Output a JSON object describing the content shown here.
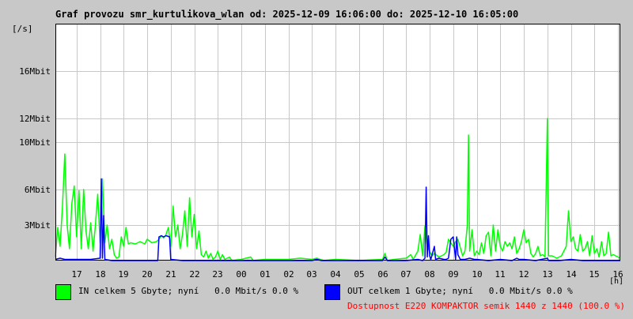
{
  "colors": {
    "background": "#c8c8c8",
    "plot_background": "#ffffff",
    "grid": "#c8c8c8",
    "in": "#00ff00",
    "out": "#0000ff",
    "availability": "#ff0000"
  },
  "chart_data": {
    "type": "line",
    "title": "Graf provozu smr_kurtulikova_wlan od: 2025-12-09 16:06:00 do: 2025-12-10 16:05:00",
    "ylabel": "[/s]",
    "xlabel": "[h]",
    "grid": true,
    "ylim": [
      0,
      20
    ],
    "xlim": [
      16.1,
      40.1
    ],
    "y_ticks": [
      {
        "value": 3,
        "label": "3Mbit"
      },
      {
        "value": 6,
        "label": "6Mbit"
      },
      {
        "value": 10,
        "label": "10Mbit"
      },
      {
        "value": 12,
        "label": "12Mbit"
      },
      {
        "value": 16,
        "label": "16Mbit"
      }
    ],
    "x_ticks": [
      {
        "value": 17,
        "label": "17"
      },
      {
        "value": 18,
        "label": "18"
      },
      {
        "value": 19,
        "label": "19"
      },
      {
        "value": 20,
        "label": "20"
      },
      {
        "value": 21,
        "label": "21"
      },
      {
        "value": 22,
        "label": "22"
      },
      {
        "value": 23,
        "label": "23"
      },
      {
        "value": 24,
        "label": "00"
      },
      {
        "value": 25,
        "label": "01"
      },
      {
        "value": 26,
        "label": "02"
      },
      {
        "value": 27,
        "label": "03"
      },
      {
        "value": 28,
        "label": "04"
      },
      {
        "value": 29,
        "label": "05"
      },
      {
        "value": 30,
        "label": "06"
      },
      {
        "value": 31,
        "label": "07"
      },
      {
        "value": 32,
        "label": "08"
      },
      {
        "value": 33,
        "label": "09"
      },
      {
        "value": 34,
        "label": "10"
      },
      {
        "value": 35,
        "label": "11"
      },
      {
        "value": 36,
        "label": "12"
      },
      {
        "value": 37,
        "label": "13"
      },
      {
        "value": 38,
        "label": "14"
      },
      {
        "value": 39,
        "label": "15"
      },
      {
        "value": 40,
        "label": "16"
      }
    ],
    "series": [
      {
        "name": "IN",
        "color": "#00ff00",
        "points": [
          [
            16.1,
            0.3
          ],
          [
            16.2,
            2.8
          ],
          [
            16.3,
            1.2
          ],
          [
            16.4,
            4.5
          ],
          [
            16.5,
            9.0
          ],
          [
            16.6,
            3.0
          ],
          [
            16.7,
            1.0
          ],
          [
            16.8,
            4.8
          ],
          [
            16.9,
            6.3
          ],
          [
            17.0,
            2.0
          ],
          [
            17.1,
            5.9
          ],
          [
            17.2,
            1.0
          ],
          [
            17.3,
            6.0
          ],
          [
            17.4,
            2.5
          ],
          [
            17.5,
            1.0
          ],
          [
            17.6,
            3.2
          ],
          [
            17.7,
            0.8
          ],
          [
            17.8,
            3.0
          ],
          [
            17.9,
            5.6
          ],
          [
            18.0,
            1.5
          ],
          [
            18.1,
            6.9
          ],
          [
            18.2,
            1.5
          ],
          [
            18.3,
            3.0
          ],
          [
            18.4,
            1.0
          ],
          [
            18.5,
            1.8
          ],
          [
            18.6,
            0.5
          ],
          [
            18.7,
            0.2
          ],
          [
            18.8,
            0.3
          ],
          [
            18.9,
            2.0
          ],
          [
            19.0,
            1.2
          ],
          [
            19.1,
            2.8
          ],
          [
            19.2,
            1.4
          ],
          [
            19.3,
            1.5
          ],
          [
            19.5,
            1.4
          ],
          [
            19.7,
            1.6
          ],
          [
            19.9,
            1.4
          ],
          [
            20.0,
            1.8
          ],
          [
            20.2,
            1.5
          ],
          [
            20.4,
            1.6
          ],
          [
            20.5,
            1.8
          ],
          [
            20.6,
            2.1
          ],
          [
            20.7,
            1.9
          ],
          [
            20.8,
            2.2
          ],
          [
            20.9,
            2.8
          ],
          [
            21.0,
            1.2
          ],
          [
            21.1,
            4.6
          ],
          [
            21.2,
            2.0
          ],
          [
            21.3,
            3.0
          ],
          [
            21.4,
            1.0
          ],
          [
            21.5,
            2.2
          ],
          [
            21.6,
            4.2
          ],
          [
            21.7,
            1.2
          ],
          [
            21.8,
            5.3
          ],
          [
            21.9,
            2.0
          ],
          [
            22.0,
            3.9
          ],
          [
            22.1,
            1.0
          ],
          [
            22.2,
            2.5
          ],
          [
            22.3,
            0.5
          ],
          [
            22.4,
            0.3
          ],
          [
            22.5,
            0.8
          ],
          [
            22.6,
            0.2
          ],
          [
            22.7,
            0.6
          ],
          [
            22.8,
            0.1
          ],
          [
            22.9,
            0.3
          ],
          [
            23.0,
            0.8
          ],
          [
            23.1,
            0.1
          ],
          [
            23.2,
            0.5
          ],
          [
            23.3,
            0.1
          ],
          [
            23.5,
            0.3
          ],
          [
            23.6,
            0.0
          ],
          [
            24.0,
            0.1
          ],
          [
            24.4,
            0.3
          ],
          [
            24.5,
            0.0
          ],
          [
            25.0,
            0.1
          ],
          [
            26.0,
            0.1
          ],
          [
            26.5,
            0.2
          ],
          [
            27.0,
            0.1
          ],
          [
            27.2,
            0.2
          ],
          [
            27.5,
            0.0
          ],
          [
            28.0,
            0.1
          ],
          [
            29.0,
            0.0
          ],
          [
            30.0,
            0.1
          ],
          [
            30.1,
            0.6
          ],
          [
            30.2,
            0.0
          ],
          [
            30.5,
            0.1
          ],
          [
            31.0,
            0.2
          ],
          [
            31.2,
            0.5
          ],
          [
            31.3,
            0.1
          ],
          [
            31.5,
            0.8
          ],
          [
            31.6,
            2.2
          ],
          [
            31.7,
            0.4
          ],
          [
            31.8,
            2.9
          ],
          [
            31.9,
            1.2
          ],
          [
            32.0,
            0.8
          ],
          [
            32.1,
            0.4
          ],
          [
            32.2,
            0.6
          ],
          [
            32.4,
            0.3
          ],
          [
            32.6,
            0.5
          ],
          [
            32.7,
            0.7
          ],
          [
            32.8,
            1.8
          ],
          [
            32.9,
            1.5
          ],
          [
            33.0,
            1.2
          ],
          [
            33.1,
            1.6
          ],
          [
            33.2,
            1.8
          ],
          [
            33.3,
            1.1
          ],
          [
            33.4,
            0.4
          ],
          [
            33.5,
            0.8
          ],
          [
            33.6,
            3.0
          ],
          [
            33.65,
            10.6
          ],
          [
            33.7,
            0.8
          ],
          [
            33.8,
            2.6
          ],
          [
            33.9,
            0.4
          ],
          [
            34.0,
            0.8
          ],
          [
            34.1,
            0.5
          ],
          [
            34.2,
            1.5
          ],
          [
            34.3,
            0.6
          ],
          [
            34.4,
            2.1
          ],
          [
            34.5,
            2.4
          ],
          [
            34.6,
            0.4
          ],
          [
            34.7,
            3.0
          ],
          [
            34.8,
            0.8
          ],
          [
            34.9,
            2.6
          ],
          [
            35.0,
            1.2
          ],
          [
            35.1,
            0.8
          ],
          [
            35.2,
            1.6
          ],
          [
            35.3,
            1.2
          ],
          [
            35.4,
            1.5
          ],
          [
            35.5,
            1.0
          ],
          [
            35.6,
            2.0
          ],
          [
            35.7,
            0.6
          ],
          [
            35.8,
            1.0
          ],
          [
            35.9,
            1.6
          ],
          [
            36.0,
            2.6
          ],
          [
            36.1,
            1.5
          ],
          [
            36.2,
            1.8
          ],
          [
            36.3,
            0.6
          ],
          [
            36.4,
            0.3
          ],
          [
            36.5,
            0.6
          ],
          [
            36.6,
            1.2
          ],
          [
            36.7,
            0.4
          ],
          [
            36.8,
            0.5
          ],
          [
            36.9,
            0.3
          ],
          [
            37.0,
            12.0
          ],
          [
            37.05,
            0.4
          ],
          [
            37.2,
            0.4
          ],
          [
            37.4,
            0.2
          ],
          [
            37.6,
            0.4
          ],
          [
            37.8,
            1.2
          ],
          [
            37.9,
            4.2
          ],
          [
            38.0,
            1.6
          ],
          [
            38.1,
            2.0
          ],
          [
            38.2,
            1.0
          ],
          [
            38.3,
            0.8
          ],
          [
            38.4,
            2.2
          ],
          [
            38.5,
            0.8
          ],
          [
            38.6,
            1.0
          ],
          [
            38.7,
            1.6
          ],
          [
            38.8,
            0.4
          ],
          [
            38.9,
            2.1
          ],
          [
            39.0,
            0.6
          ],
          [
            39.1,
            1.0
          ],
          [
            39.2,
            0.3
          ],
          [
            39.3,
            1.6
          ],
          [
            39.4,
            0.4
          ],
          [
            39.5,
            0.6
          ],
          [
            39.6,
            2.4
          ],
          [
            39.7,
            0.4
          ],
          [
            39.8,
            0.5
          ],
          [
            40.0,
            0.3
          ],
          [
            40.1,
            0.2
          ]
        ]
      },
      {
        "name": "OUT",
        "color": "#0000ff",
        "points": [
          [
            16.1,
            0.1
          ],
          [
            16.3,
            0.2
          ],
          [
            16.5,
            0.1
          ],
          [
            16.8,
            0.1
          ],
          [
            17.2,
            0.1
          ],
          [
            17.6,
            0.1
          ],
          [
            18.0,
            0.2
          ],
          [
            18.05,
            6.9
          ],
          [
            18.1,
            0.2
          ],
          [
            18.15,
            3.8
          ],
          [
            18.2,
            0.1
          ],
          [
            18.5,
            0.0
          ],
          [
            19.0,
            0.0
          ],
          [
            19.5,
            0.0
          ],
          [
            20.0,
            0.0
          ],
          [
            20.45,
            0.0
          ],
          [
            20.5,
            2.0
          ],
          [
            20.6,
            2.1
          ],
          [
            20.7,
            2.0
          ],
          [
            20.8,
            2.1
          ],
          [
            20.95,
            2.0
          ],
          [
            21.0,
            0.1
          ],
          [
            21.5,
            0.0
          ],
          [
            22.0,
            0.0
          ],
          [
            23.0,
            0.0
          ],
          [
            24.0,
            0.0
          ],
          [
            25.0,
            0.0
          ],
          [
            26.0,
            0.0
          ],
          [
            27.0,
            0.0
          ],
          [
            27.2,
            0.1
          ],
          [
            27.4,
            0.0
          ],
          [
            28.0,
            0.0
          ],
          [
            29.0,
            0.0
          ],
          [
            30.0,
            0.0
          ],
          [
            30.1,
            0.3
          ],
          [
            30.2,
            0.0
          ],
          [
            31.0,
            0.0
          ],
          [
            31.5,
            0.1
          ],
          [
            31.7,
            0.0
          ],
          [
            31.8,
            0.2
          ],
          [
            31.85,
            6.2
          ],
          [
            31.9,
            0.3
          ],
          [
            31.95,
            2.1
          ],
          [
            32.0,
            0.4
          ],
          [
            32.05,
            0.1
          ],
          [
            32.2,
            1.2
          ],
          [
            32.25,
            0.1
          ],
          [
            32.4,
            0.2
          ],
          [
            32.6,
            0.1
          ],
          [
            32.7,
            0.1
          ],
          [
            32.8,
            0.2
          ],
          [
            32.9,
            1.8
          ],
          [
            33.0,
            2.0
          ],
          [
            33.1,
            0.1
          ],
          [
            33.15,
            2.0
          ],
          [
            33.2,
            0.5
          ],
          [
            33.3,
            0.1
          ],
          [
            33.5,
            0.1
          ],
          [
            33.7,
            0.2
          ],
          [
            33.9,
            0.1
          ],
          [
            34.0,
            0.1
          ],
          [
            34.5,
            0.0
          ],
          [
            35.0,
            0.1
          ],
          [
            35.5,
            0.0
          ],
          [
            35.7,
            0.2
          ],
          [
            35.8,
            0.1
          ],
          [
            36.0,
            0.1
          ],
          [
            36.5,
            0.0
          ],
          [
            37.0,
            0.2
          ],
          [
            37.05,
            0.0
          ],
          [
            37.5,
            0.0
          ],
          [
            38.0,
            0.1
          ],
          [
            38.5,
            0.0
          ],
          [
            39.0,
            0.0
          ],
          [
            39.5,
            0.0
          ],
          [
            40.1,
            0.0
          ]
        ]
      }
    ]
  },
  "legend": {
    "in_text": "IN celkem 5 Gbyte; nyní   0.0 Mbit/s 0.0 %",
    "out_text": "OUT celkem 1 Gbyte; nyní   0.0 Mbit/s 0.0 %",
    "availability_text": "Dostupnost E220 KOMPAKTOR semik 1440 z 1440 (100.0 %)"
  }
}
